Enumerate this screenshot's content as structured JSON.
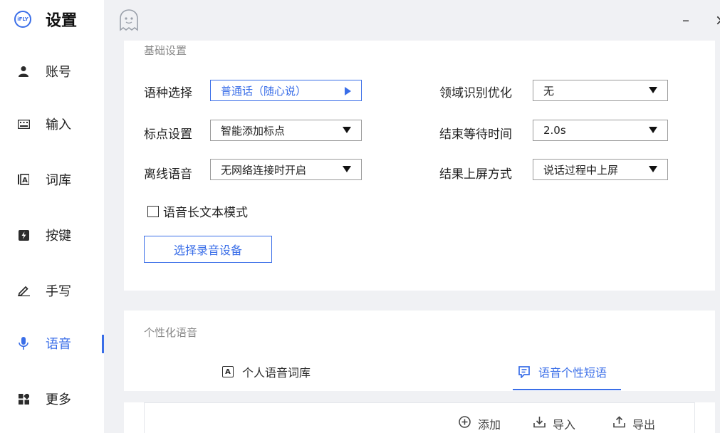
{
  "app": {
    "logo_text": "iFLY",
    "title": "设置"
  },
  "sidebar": {
    "items": [
      {
        "label": "账号",
        "icon": "user-icon"
      },
      {
        "label": "输入",
        "icon": "keyboard-icon"
      },
      {
        "label": "词库",
        "icon": "dictionary-icon"
      },
      {
        "label": "按键",
        "icon": "key-icon"
      },
      {
        "label": "手写",
        "icon": "pen-icon"
      },
      {
        "label": "语音",
        "icon": "microphone-icon",
        "active": true
      },
      {
        "label": "更多",
        "icon": "grid-icon"
      }
    ]
  },
  "window": {
    "minimize": "–",
    "close": "×"
  },
  "basic": {
    "title": "基础设置",
    "language_label": "语种选择",
    "language_value": "普通话（随心说）",
    "punct_label": "标点设置",
    "punct_value": "智能添加标点",
    "offline_label": "离线语音",
    "offline_value": "无网络连接时开启",
    "domain_label": "领域识别优化",
    "domain_value": "无",
    "wait_label": "结束等待时间",
    "wait_value": "2.0s",
    "screen_label": "结果上屏方式",
    "screen_value": "说话过程中上屏",
    "longtext_label": "语音长文本模式",
    "longtext_checked": false,
    "device_button": "选择录音设备"
  },
  "personal": {
    "title": "个性化语音",
    "tabs": [
      {
        "label": "个人语音词库",
        "icon": "dictionary-icon",
        "active": false
      },
      {
        "label": "语音个性短语",
        "icon": "phrase-icon",
        "active": true
      }
    ],
    "actions": {
      "add": "添加",
      "import": "导入",
      "export": "导出"
    }
  },
  "colors": {
    "accent": "#3a6ee8",
    "background": "#f0f1f4"
  }
}
